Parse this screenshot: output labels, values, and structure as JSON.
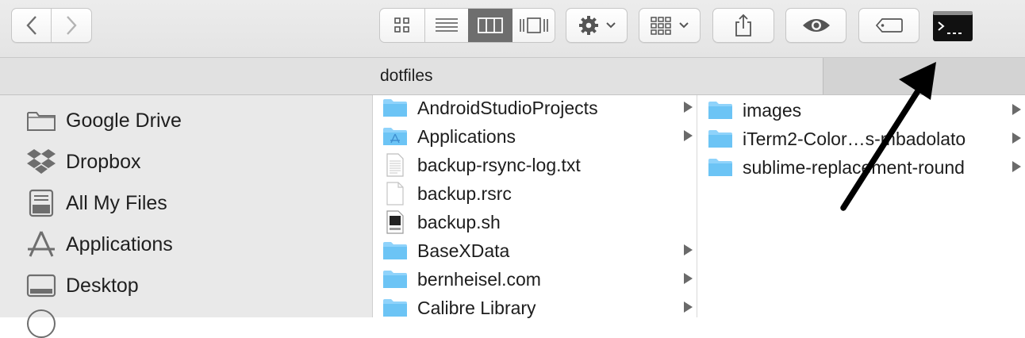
{
  "window": {
    "path_title": "dotfiles"
  },
  "toolbar": {
    "back": "chevron-left-icon",
    "forward": "chevron-right-icon",
    "view_modes": [
      "icon-view",
      "list-view",
      "column-view",
      "cover-flow-view"
    ],
    "active_view": "column-view",
    "action": "gear-icon",
    "group": "group-by-icon",
    "share": "share-icon",
    "quicklook": "eye-icon",
    "tags": "tag-icon",
    "terminal": "terminal-icon"
  },
  "sidebar": {
    "items": [
      {
        "label": "Google Drive",
        "icon": "folder-icon"
      },
      {
        "label": "Dropbox",
        "icon": "dropbox-icon"
      },
      {
        "label": "All My Files",
        "icon": "all-files-icon"
      },
      {
        "label": "Applications",
        "icon": "applications-icon"
      },
      {
        "label": "Desktop",
        "icon": "desktop-icon"
      }
    ]
  },
  "column1": {
    "items": [
      {
        "name": "AndroidStudioProjects",
        "kind": "folder",
        "has_children": true
      },
      {
        "name": "Applications",
        "kind": "applications-folder",
        "has_children": true
      },
      {
        "name": "backup-rsync-log.txt",
        "kind": "text-file",
        "has_children": false
      },
      {
        "name": "backup.rsrc",
        "kind": "file",
        "has_children": false
      },
      {
        "name": "backup.sh",
        "kind": "shell-script",
        "has_children": false
      },
      {
        "name": "BaseXData",
        "kind": "folder",
        "has_children": true
      },
      {
        "name": "bernheisel.com",
        "kind": "folder",
        "has_children": true
      },
      {
        "name": "Calibre Library",
        "kind": "folder",
        "has_children": true
      }
    ]
  },
  "column2": {
    "items": [
      {
        "name": "images",
        "kind": "folder",
        "has_children": true
      },
      {
        "name": "iTerm2-Color…s-mbadolato",
        "kind": "folder",
        "has_children": true
      },
      {
        "name": "sublime-replacement-round",
        "kind": "folder",
        "has_children": true
      }
    ]
  },
  "colors": {
    "folder": "#6cc4f5",
    "toolbar_bg": "#e8e8e8",
    "sidebar_bg": "#e9e9e9",
    "active_segment": "#6e6e6e",
    "annotation_arrow": "#000000"
  }
}
